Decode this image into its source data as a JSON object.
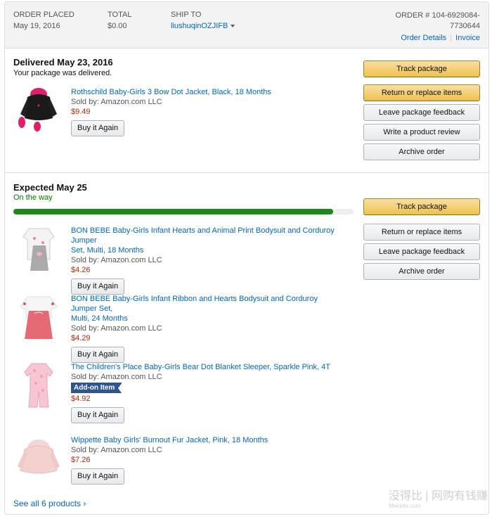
{
  "header": {
    "order_placed_label": "ORDER PLACED",
    "order_placed_value": "May 19, 2016",
    "total_label": "TOTAL",
    "total_value": "$0.00",
    "ship_to_label": "SHIP TO",
    "ship_to_value": "liushuqinOZJIFB",
    "order_number_line1": "ORDER # 104-6929084-",
    "order_number_line2": "7730644",
    "order_details_link": "Order Details",
    "invoice_link": "Invoice"
  },
  "shipments": [
    {
      "title": "Delivered May 23, 2016",
      "subtitle": "Your package was delivered.",
      "actions": [
        "Track package",
        "Return or replace items",
        "Leave package feedback",
        "Write a product review",
        "Archive order"
      ],
      "items": [
        {
          "title": "Rothschild Baby-Girls 3 Bow Dot Jacket, Black, 18 Months",
          "sold_by": "Sold by: Amazon.com LLC",
          "price": "$9.49",
          "button": "Buy it Again"
        }
      ]
    },
    {
      "title": "Expected May 25",
      "subtitle": "On the way",
      "progress": 0.94,
      "actions": [
        "Track package",
        "Return or replace items",
        "Leave package feedback",
        "Archive order"
      ],
      "items": [
        {
          "title_line1": "BON BEBE Baby-Girls Infant Hearts and Animal Print Bodysuit and Corduroy Jumper",
          "title_line2": "Set, Multi, 18 Months",
          "sold_by": "Sold by: Amazon.com LLC",
          "price": "$4.26",
          "button": "Buy it Again"
        },
        {
          "title_line1": "BON BEBE Baby-Girls Infant Ribbon and Hearts Bodysuit and Corduroy Jumper Set,",
          "title_line2": "Multi, 24 Months",
          "sold_by": "Sold by: Amazon.com LLC",
          "price": "$4.29",
          "button": "Buy it Again"
        },
        {
          "title": "The Children's Place Baby-Girls Bear Dot Blanket Sleeper, Sparkle Pink, 4T",
          "sold_by": "Sold by: Amazon.com LLC",
          "badge": "Add-on Item",
          "price": "$4.92",
          "button": "Buy it Again"
        },
        {
          "title": "Wippette Baby Girls' Burnout Fur Jacket, Pink, 18 Months",
          "sold_by": "Sold by: Amazon.com LLC",
          "price": "$7.26",
          "button": "Buy it Again"
        }
      ],
      "see_all": "See all 6 products ›"
    }
  ],
  "colors": {
    "link": "#0066c0",
    "price": "#b12704",
    "status_green": "#007600",
    "primary_button": "#f0c14b",
    "addon_badge": "#30558d"
  },
  "watermark": {
    "main": "没得比 | 网购有钱赚",
    "sub": "Meidebi.com"
  }
}
